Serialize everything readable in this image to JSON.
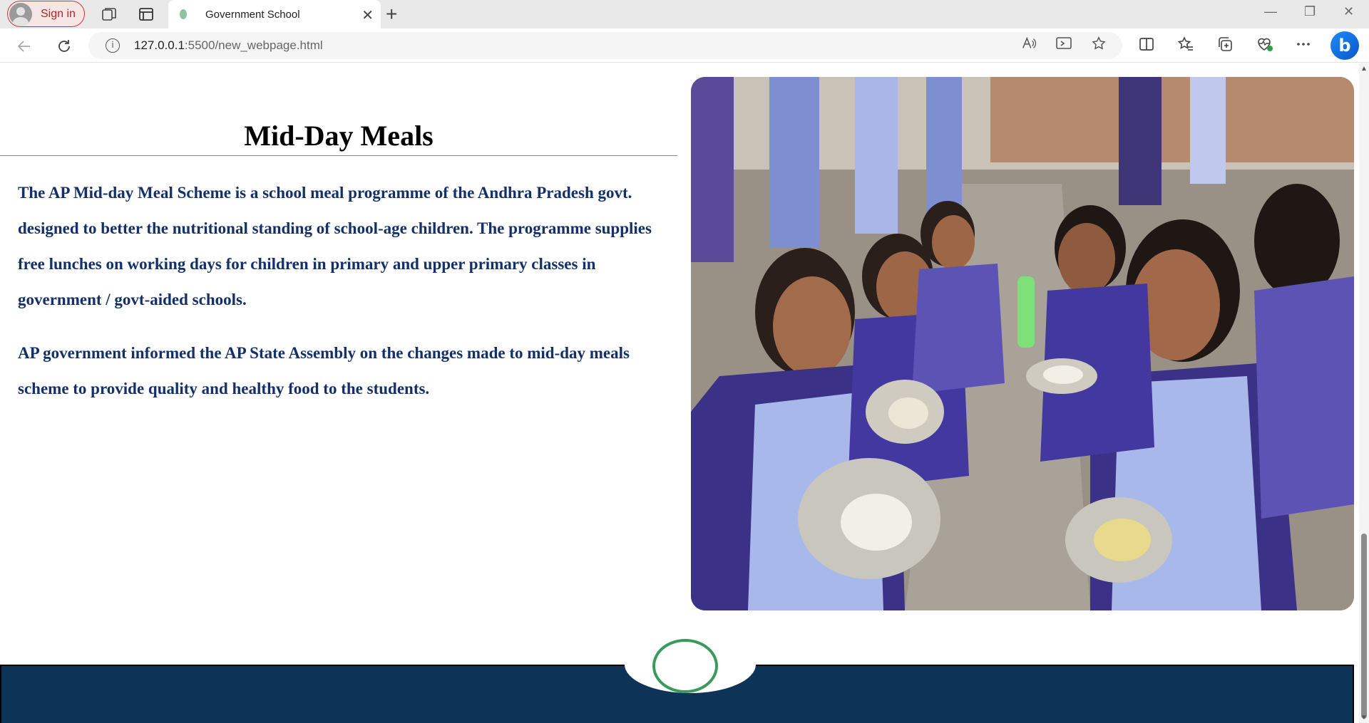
{
  "browser": {
    "signin_label": "Sign in",
    "tab": {
      "title": "Government School",
      "close_glyph": "✕"
    },
    "new_tab_glyph": "+",
    "address": {
      "host": "127.0.0.1",
      "path": ":5500/new_webpage.html"
    },
    "window_controls": {
      "minimize": "—",
      "restore": "❐",
      "close": "✕"
    }
  },
  "section": {
    "heading": "Mid-Day Meals",
    "paragraphs": [
      "The AP Mid-day Meal Scheme is a school meal programme of the Andhra Pradesh govt. designed to better the nutritional standing of school-age children. The programme supplies free lunches on working days for children in primary and upper primary classes in government / govt-aided schools.",
      "AP government informed the AP State Assembly on the changes made to mid-day meals scheme to provide quality and healthy food to the students."
    ]
  },
  "colors": {
    "paragraph_text": "#14306a",
    "footer_bg": "#0d3457",
    "signin_accent": "#c23b3b"
  },
  "icons": {
    "back": "arrow-left-icon",
    "reload": "reload-icon",
    "info": "info-icon",
    "read_aloud": "read-aloud-icon",
    "immersive": "immersive-reader-icon",
    "favorite": "star-icon",
    "split": "split-screen-icon",
    "favorites": "favorites-icon",
    "collections": "collections-icon",
    "performance": "performance-heart-icon",
    "more": "more-icon",
    "copilot": "copilot-icon"
  }
}
